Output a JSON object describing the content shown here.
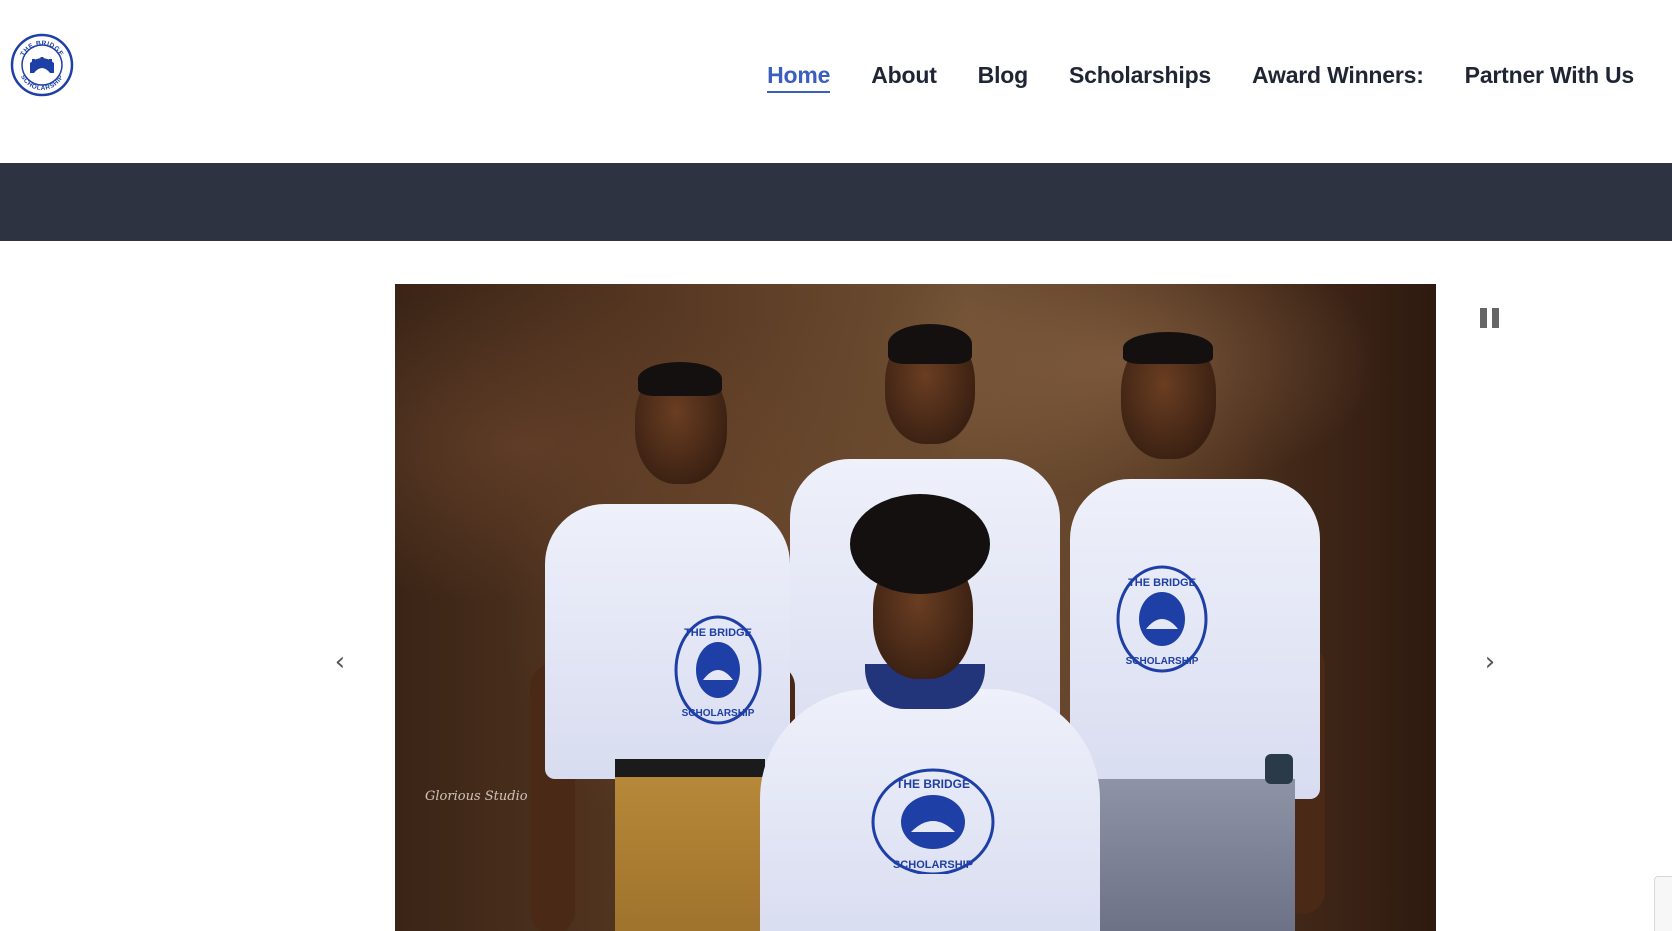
{
  "site": {
    "logo": {
      "top_text": "THE BRIDGE",
      "bottom_text": "SCHOLARSHIP"
    }
  },
  "nav": {
    "items": [
      {
        "label": "Home",
        "active": true
      },
      {
        "label": "About",
        "active": false
      },
      {
        "label": "Blog",
        "active": false
      },
      {
        "label": "Scholarships",
        "active": false
      },
      {
        "label": "Award Winners:",
        "active": false
      },
      {
        "label": "Partner With Us",
        "active": false
      }
    ]
  },
  "slider": {
    "photo_signature": "Glorious Studio",
    "shirt_emblem": {
      "top_text": "THE BRIDGE",
      "bottom_text": "SCHOLARSHIP"
    },
    "pause_icon": "pause-icon",
    "prev_icon": "chevron-left-icon",
    "next_icon": "chevron-right-icon",
    "prev_glyph": "‹",
    "next_glyph": "›"
  },
  "colors": {
    "accent": "#3b5fc0",
    "nav_text": "#1f2533",
    "banner": "#2d3340",
    "emblem_blue": "#1e3fa6"
  }
}
